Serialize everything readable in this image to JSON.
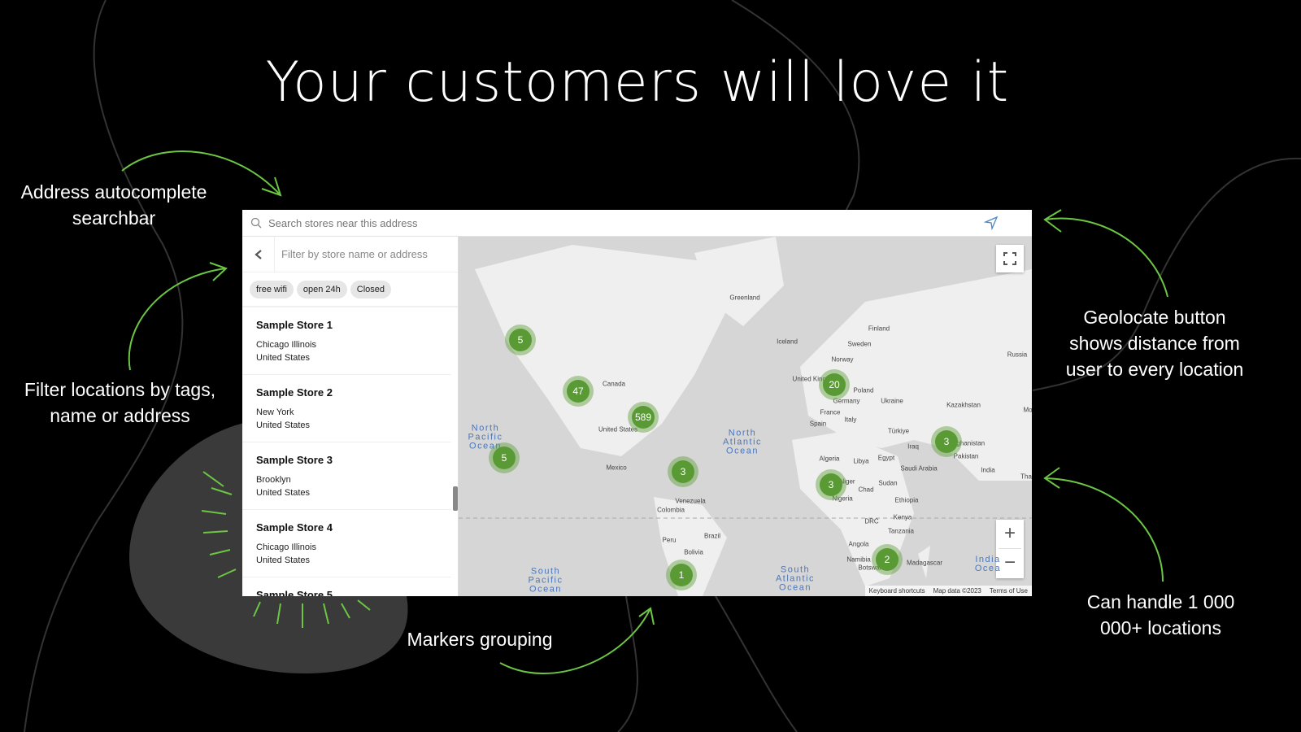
{
  "headline": "Your customers will love it",
  "notes": {
    "search": "Address autocomplete searchbar",
    "filter": "Filter locations by tags, name or address",
    "markers": "Markers grouping",
    "geolocate": "Geolocate button shows distance from user to every location",
    "scale": "Can handle 1 000 000+ locations"
  },
  "accent": "#6cc644",
  "search": {
    "placeholder": "Search stores near this address",
    "icon": "search-icon",
    "geolocate_icon": "navigation-arrow-icon"
  },
  "sidebar": {
    "filter_placeholder": "Filter by store name or address",
    "tags": [
      "free wifi",
      "open 24h",
      "Closed"
    ],
    "stores": [
      {
        "name": "Sample Store 1",
        "line1": "Chicago Illinois",
        "line2": "United States"
      },
      {
        "name": "Sample Store 2",
        "line1": "New York",
        "line2": "United States"
      },
      {
        "name": "Sample Store 3",
        "line1": "Brooklyn",
        "line2": "United States"
      },
      {
        "name": "Sample Store 4",
        "line1": "Chicago Illinois",
        "line2": "United States"
      },
      {
        "name": "Sample Store 5",
        "line1": "",
        "line2": ""
      }
    ]
  },
  "map": {
    "clusters": [
      "5",
      "47",
      "589",
      "5",
      "3",
      "1",
      "20",
      "3",
      "3",
      "2"
    ],
    "labels": [
      "Greenland",
      "Iceland",
      "Finland",
      "Sweden",
      "Norway",
      "Russia",
      "United Kingdom",
      "Poland",
      "Germany",
      "Ukraine",
      "Kazakhstan",
      "France",
      "Italy",
      "Spain",
      "Türkiye",
      "Iraq",
      "Afghanistan",
      "Pakistan",
      "India",
      "Algeria",
      "Libya",
      "Egypt",
      "Saudi Arabia",
      "Niger",
      "Chad",
      "Sudan",
      "Nigeria",
      "Ethiopia",
      "Canada",
      "United States",
      "Mexico",
      "Venezuela",
      "Colombia",
      "Peru",
      "Brazil",
      "Bolivia",
      "DRC",
      "Kenya",
      "Tanzania",
      "Angola",
      "Namibia",
      "Botswana",
      "Madagascar",
      "Tha",
      "Mo"
    ],
    "oceans": [
      "North Pacific Ocean",
      "North Atlantic Ocean",
      "South Pacific Ocean",
      "South Atlantic Ocean",
      "India Ocea"
    ],
    "attribution": [
      "Keyboard shortcuts",
      "Map data ©2023",
      "Terms of Use"
    ],
    "zoom_in": "+",
    "zoom_out": "−"
  }
}
